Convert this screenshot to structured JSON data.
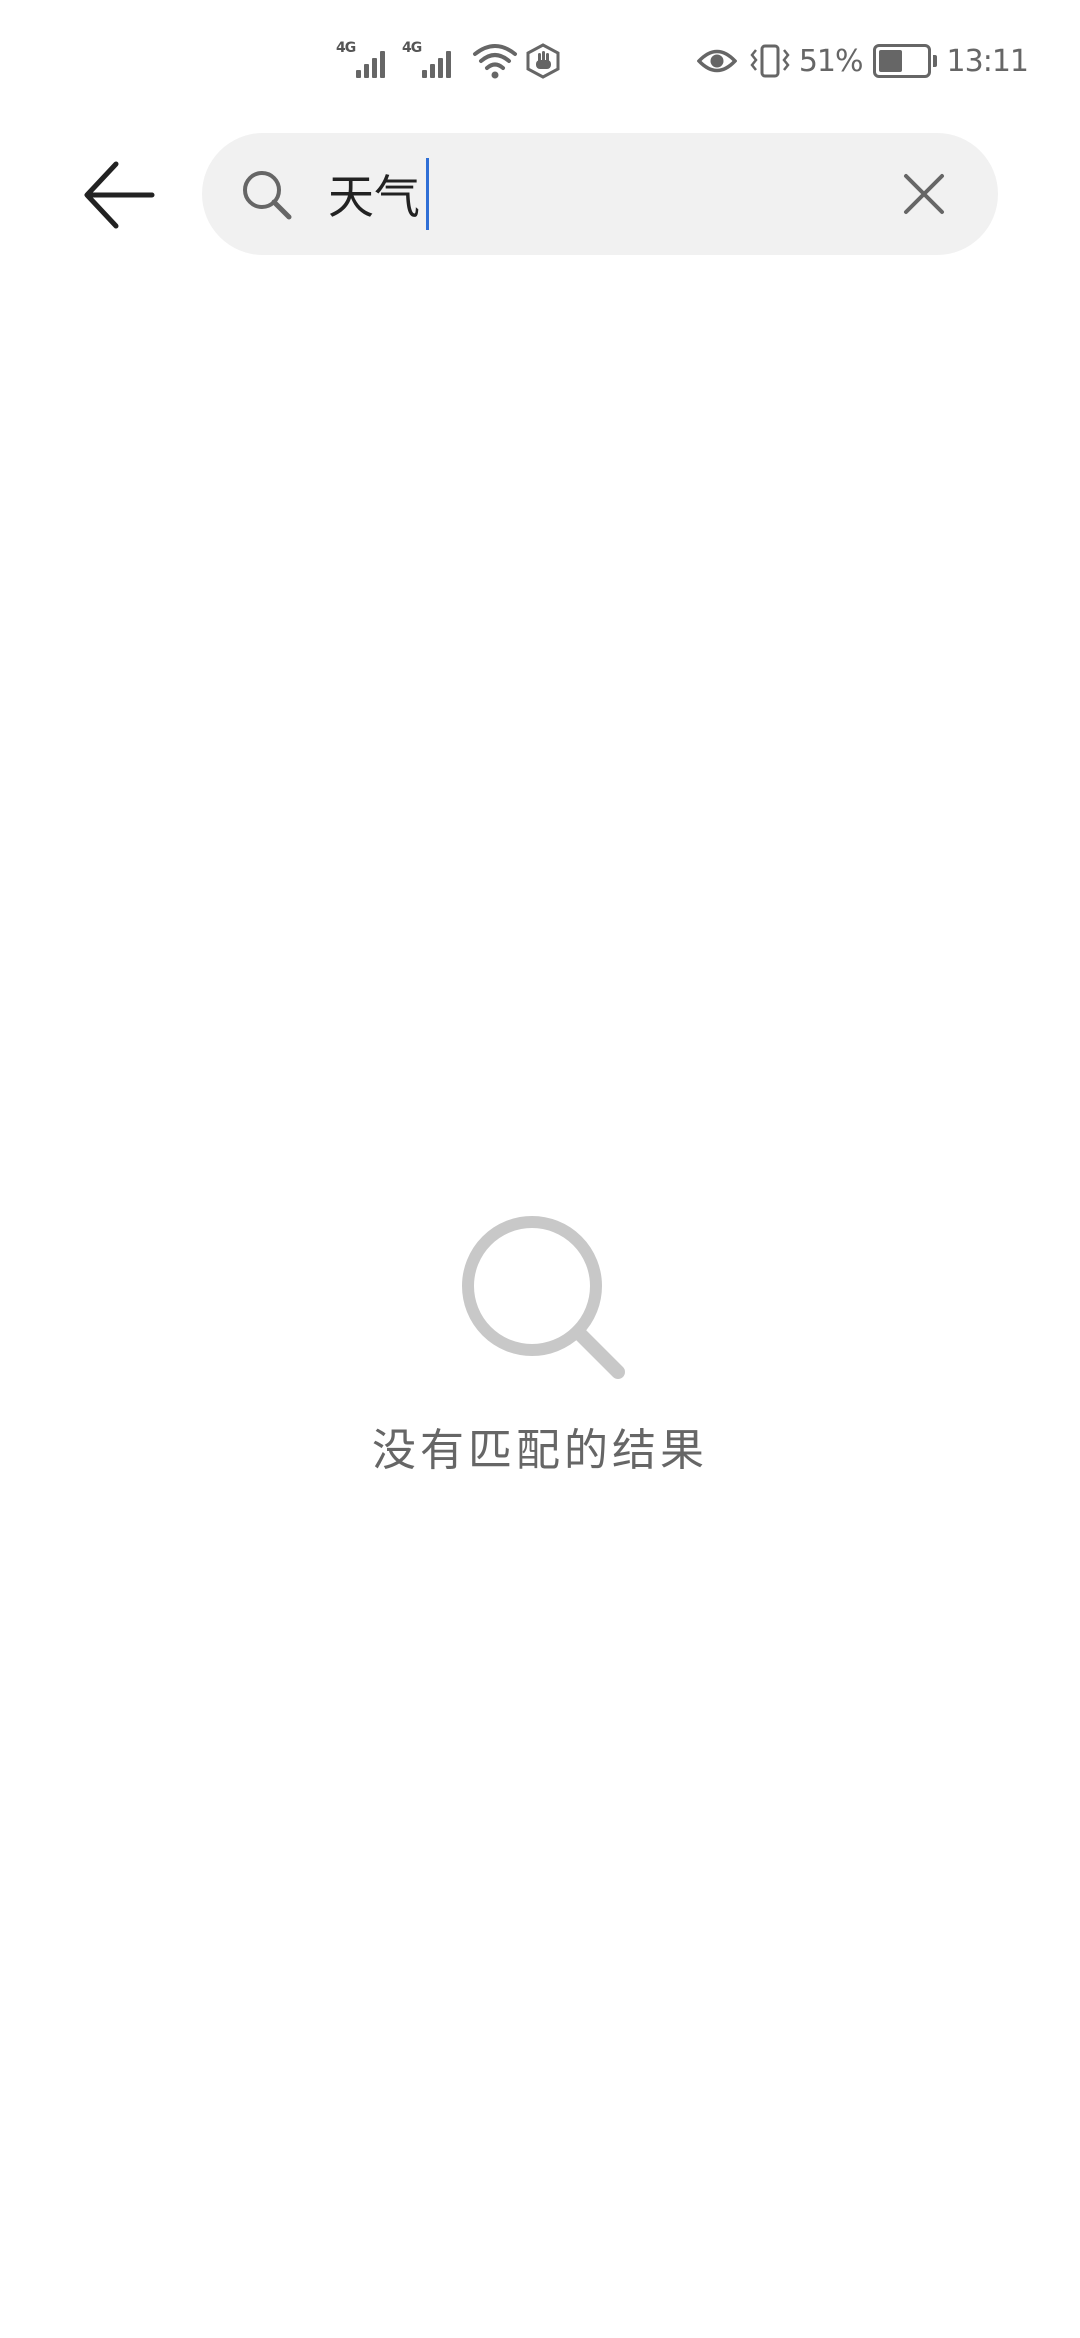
{
  "status_bar": {
    "network_1": "4G",
    "network_2": "4G",
    "battery_percent": "51%",
    "battery_level": 0.51,
    "time": "13:11"
  },
  "search": {
    "query": "天气"
  },
  "empty_state": {
    "message": "没有匹配的结果"
  },
  "icons": {
    "back": "arrow-left-icon",
    "search": "search-icon",
    "clear": "close-icon",
    "empty": "search-icon"
  },
  "colors": {
    "caret": "#2f6fd6",
    "search_background": "#f1f1f1",
    "empty_icon": "#c8c8c8"
  }
}
